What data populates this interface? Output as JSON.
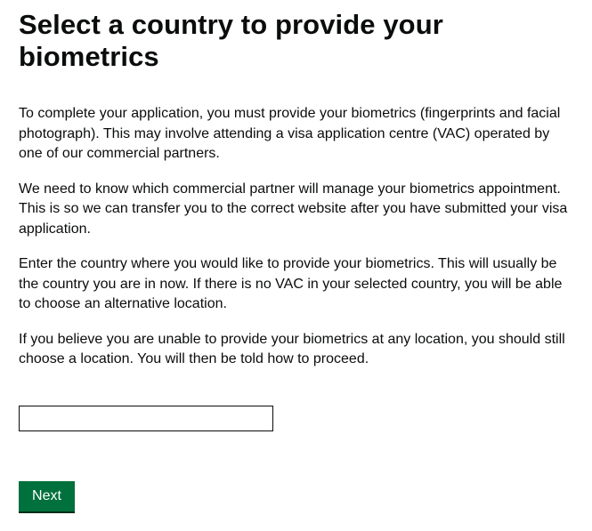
{
  "page": {
    "title": "Select a country to provide your biometrics",
    "paragraphs": [
      "To complete your application, you must provide your biometrics (fingerprints and facial photograph). This may involve attending a visa application centre (VAC) operated by one of our commercial partners.",
      "We need to know which commercial partner will manage your biometrics appointment. This is so we can transfer you to the correct website after you have submitted your visa application.",
      "Enter the country where you would like to provide your biometrics. This will usually be the country you are in now. If there is no VAC in your selected country, you will be able to choose an alternative location.",
      "If you believe you are unable to provide your biometrics at any location, you should still choose a location. You will then be told how to proceed."
    ]
  },
  "form": {
    "country_value": "",
    "next_label": "Next"
  },
  "colors": {
    "text": "#0b0c0c",
    "button": "#00703c",
    "button_shadow": "#002d18"
  }
}
